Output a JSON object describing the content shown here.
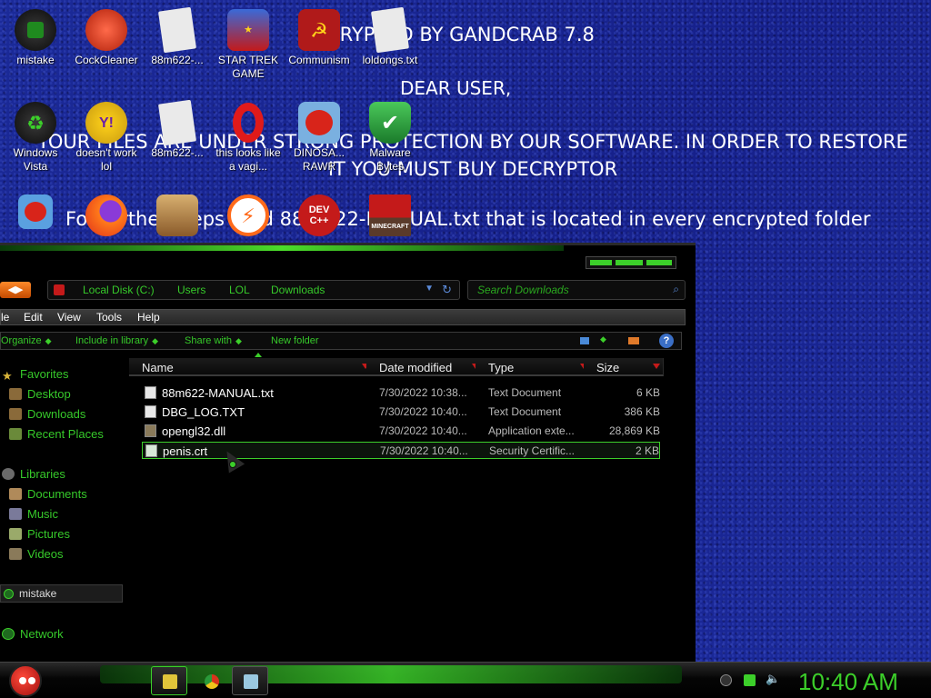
{
  "ransom": {
    "line1": "ENCRYPTED BY GANDCRAB 7.8",
    "line2": "DEAR USER,",
    "line3": "YOUR FILES ARE UNDER STRONG PROTECTION BY OUR SOFTWARE. IN ORDER TO RESTORE IT YOU MUST BUY DECRYPTOR",
    "line4": "For further steps read 88m622-MANUAL.txt that is located in every encrypted folder"
  },
  "desktop_icons": [
    {
      "label": "mistake",
      "icon": "green-orb-icon",
      "color": "#1f6a1f"
    },
    {
      "label": "CockCleaner",
      "icon": "ccleaner-icon",
      "color": "#d8341c"
    },
    {
      "label": "88m622-...",
      "icon": "text-file-icon",
      "color": "#e0e0e0"
    },
    {
      "label": "STAR TREK GAME",
      "icon": "star-wars-game-icon",
      "color": "#2a55b0"
    },
    {
      "label": "Communism",
      "icon": "communism-icon",
      "color": "#b01a1a"
    },
    {
      "label": "loldongs.txt",
      "icon": "text-file-icon",
      "color": "#e0e0e0"
    },
    {
      "label": "Windows Vista",
      "icon": "recycle-bin-icon",
      "color": "#1f6a1f"
    },
    {
      "label": "doesn't work lol",
      "icon": "yahoo-messenger-icon",
      "color": "#6a1fa8"
    },
    {
      "label": "88m622-...",
      "icon": "text-file-icon",
      "color": "#e0e0e0"
    },
    {
      "label": "this looks like a vagi...",
      "icon": "opera-icon",
      "color": "#d81a1a"
    },
    {
      "label": "DINOSA... RAWR",
      "icon": "angry-birds-icon",
      "color": "#d8341c"
    },
    {
      "label": "Malware Bytes",
      "icon": "shield-check-icon",
      "color": "#2a9a3a"
    },
    {
      "label": "",
      "icon": "angry-birds-icon",
      "color": "#3a8ad8"
    },
    {
      "label": "",
      "icon": "firefox-icon",
      "color": "#ff7a1a"
    },
    {
      "label": "",
      "icon": "angry-birds-seasons-icon",
      "color": "#c8a060"
    },
    {
      "label": "",
      "icon": "lightning-app-icon",
      "color": "#ff6a1a"
    },
    {
      "label": "",
      "icon": "devcpp-icon",
      "color": "#c41a1a"
    },
    {
      "label": "",
      "icon": "minecraft-icon",
      "color": "#5a3a2a"
    }
  ],
  "devcpp_text": "DEV C++",
  "minecraft_text": "MINECRAFT",
  "explorer": {
    "breadcrumbs": [
      "Local Disk (C:)",
      "Users",
      "LOL",
      "Downloads"
    ],
    "search_placeholder": "Search Downloads",
    "menu": [
      "le",
      "Edit",
      "View",
      "Tools",
      "Help"
    ],
    "commands": [
      "Organize",
      "Include in library",
      "Share with",
      "New folder"
    ],
    "sidebar": {
      "favorites": "Favorites",
      "desktop": "Desktop",
      "downloads": "Downloads",
      "recent": "Recent Places",
      "libraries": "Libraries",
      "documents": "Documents",
      "music": "Music",
      "pictures": "Pictures",
      "videos": "Videos",
      "homegroup": "mistake",
      "network": "Network"
    },
    "columns": [
      "Name",
      "Date modified",
      "Type",
      "Size"
    ],
    "files": [
      {
        "name": "88m622-MANUAL.txt",
        "date": "7/30/2022 10:38...",
        "type": "Text Document",
        "size": "6 KB",
        "icon": "text-file-icon"
      },
      {
        "name": "DBG_LOG.TXT",
        "date": "7/30/2022 10:40...",
        "type": "Text Document",
        "size": "386 KB",
        "icon": "text-file-icon"
      },
      {
        "name": "opengl32.dll",
        "date": "7/30/2022 10:40...",
        "type": "Application exte...",
        "size": "28,869 KB",
        "icon": "dll-file-icon"
      },
      {
        "name": "penis.crt",
        "date": "7/30/2022 10:40...",
        "type": "Security Certific...",
        "size": "2 KB",
        "icon": "certificate-file-icon",
        "selected": true
      }
    ]
  },
  "taskbar": {
    "clock": "10:40 AM"
  },
  "colors": {
    "accent": "#3ccf2a",
    "desktop_bg": "#1a2690",
    "window_bg": "#000000"
  }
}
